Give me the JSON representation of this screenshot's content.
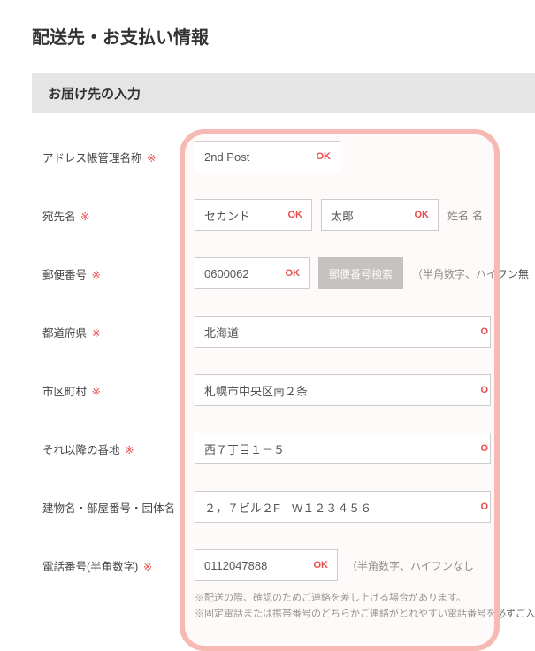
{
  "page_title": "配送先・お支払い情報",
  "section_header": "お届け先の入力",
  "required_mark": "※",
  "ok_text": "OK",
  "ok_cut": "O",
  "labels": {
    "address_book_name": "アドレス帳管理名称",
    "recipient_name": "宛先名",
    "postal_code": "郵便番号",
    "prefecture": "都道府県",
    "city": "市区町村",
    "street": "それ以降の番地",
    "building": "建物名・部屋番号・団体名",
    "phone": "電話番号(半角数字)"
  },
  "values": {
    "address_book_name": "2nd Post",
    "last_name": "セカンド",
    "first_name": "太郎",
    "postal_code": "0600062",
    "prefecture": "北海道",
    "city": "札幌市中央区南２条",
    "street": "西７丁目１－５",
    "building": "２，７ビル２F　W１２３４５６",
    "phone": "0112047888"
  },
  "buttons": {
    "postal_search": "郵便番号検索"
  },
  "hints": {
    "name_suffix": "姓名",
    "name_suffix_cut": "名",
    "postal_hint": "（半角数字、ハイフン無",
    "phone_hint": "（半角数字、ハイフンなし"
  },
  "notes": {
    "line1": "※配送の際、確認のためご連絡を差し上げる場合があります。",
    "line2": "※固定電話または携帯番号のどちらかご連絡がとれやすい電話番号を必ずご入"
  }
}
